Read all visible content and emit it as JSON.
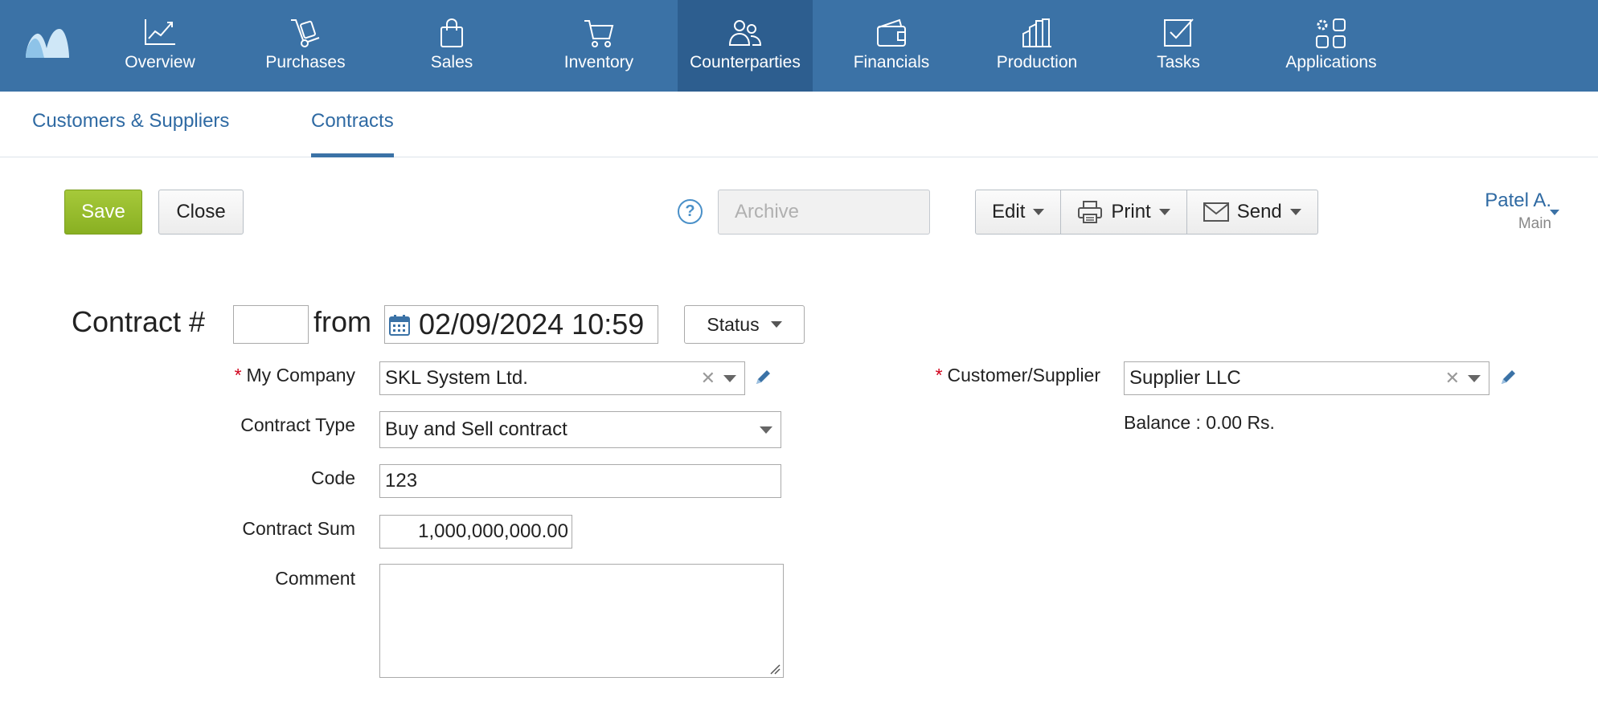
{
  "nav": {
    "items": [
      {
        "label": "Overview",
        "icon": "chart-line-icon"
      },
      {
        "label": "Purchases",
        "icon": "hand-truck-icon"
      },
      {
        "label": "Sales",
        "icon": "shopping-bag-icon"
      },
      {
        "label": "Inventory",
        "icon": "cart-icon"
      },
      {
        "label": "Counterparties",
        "icon": "people-icon",
        "active": true
      },
      {
        "label": "Financials",
        "icon": "wallet-icon"
      },
      {
        "label": "Production",
        "icon": "factory-icon"
      },
      {
        "label": "Tasks",
        "icon": "checkbox-icon"
      },
      {
        "label": "Applications",
        "icon": "apps-icon"
      }
    ]
  },
  "subtabs": [
    {
      "label": "Customers & Suppliers"
    },
    {
      "label": "Contracts",
      "active": true
    }
  ],
  "toolbar": {
    "save_label": "Save",
    "close_label": "Close",
    "help_label": "?",
    "archive_label": "Archive",
    "edit_label": "Edit",
    "print_label": "Print",
    "send_label": "Send"
  },
  "user": {
    "name": "Patel A.",
    "org": "Main"
  },
  "form": {
    "title": "Contract #",
    "number": "",
    "from_label": "from",
    "date": "02/09/2024 10:59",
    "status_label": "Status",
    "my_company_label": "My Company",
    "my_company_value": "SKL System Ltd.",
    "contract_type_label": "Contract Type",
    "contract_type_value": "Buy and Sell contract",
    "code_label": "Code",
    "code_value": "123",
    "sum_label": "Contract Sum",
    "sum_value": "1,000,000,000.00",
    "comment_label": "Comment",
    "comment_value": "",
    "customer_label": "Customer/Supplier",
    "customer_value": "Supplier LLC",
    "balance_text": "Balance : 0.00 Rs.",
    "required_mark": "*",
    "clear_mark": "✕"
  },
  "colors": {
    "nav_bg": "#3b72a6",
    "nav_active": "#2d5e8f",
    "save_green": "#97bc2c",
    "link_blue": "#2f6aa3",
    "required_red": "#d0021b"
  }
}
